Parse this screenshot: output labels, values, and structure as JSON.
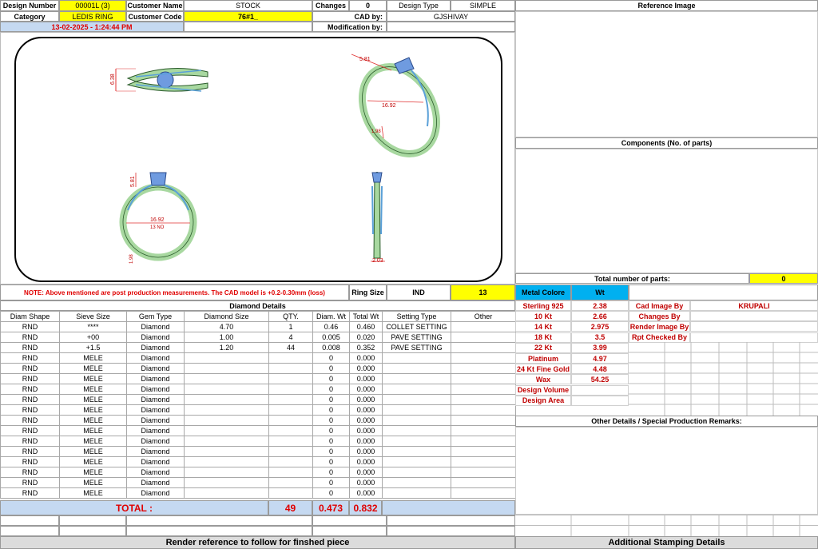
{
  "header": {
    "design_number_label": "Design Number",
    "design_number": "00001L (3)",
    "customer_name_label": "Customer Name",
    "customer_name": "STOCK",
    "changes_label": "Changes",
    "changes": "0",
    "design_type_label": "Design Type",
    "design_type": "SIMPLE",
    "category_label": "Category",
    "category": "LEDIS RING",
    "customer_code_label": "Customer Code",
    "customer_code": "76#1_",
    "cad_by_label": "CAD by:",
    "cad_by": "GJSHIVAY",
    "date": "13-02-2025 - 1:24:44 PM",
    "modification_label": "Modification by:"
  },
  "right_panel": {
    "reference_image": "Reference Image",
    "components": "Components (No. of parts)",
    "total_parts_label": "Total number of parts:",
    "total_parts": "0",
    "other_details": "Other Details / Special Production Remarks:",
    "stamping": "Additional Stamping Details"
  },
  "drawing": {
    "dim_top_height": "6.38",
    "dim_side_height": "5.81",
    "dim_side_width": "16.92",
    "dim_side_shank": "1.98",
    "dim_front_height": "5.81",
    "dim_front_width": "16.92",
    "dim_front_size": "13 NO",
    "dim_front_shank": "1.98",
    "dim_profile": "2.03"
  },
  "note": {
    "text": "NOTE: Above mentioned are post production measurements. The CAD model is +0.2-0.30mm (loss)",
    "ring_size_label": "Ring Size",
    "ring_size_system": "IND",
    "ring_size": "13",
    "metal_colore_label": "Metal Colore",
    "wt_label": "Wt"
  },
  "diamond": {
    "title": "Diamond Details",
    "headers": [
      "Diam Shape",
      "Sieve Size",
      "Gem Type",
      "Diamond Size",
      "QTY.",
      "Diam. Wt",
      "Total Wt",
      "Setting Type",
      "Other"
    ],
    "rows": [
      [
        "RND",
        "****",
        "Diamond",
        "4.70",
        "1",
        "0.46",
        "0.460",
        "COLLET SETTING",
        ""
      ],
      [
        "RND",
        "+00",
        "Diamond",
        "1.00",
        "4",
        "0.005",
        "0.020",
        "PAVE SETTING",
        ""
      ],
      [
        "RND",
        "+1.5",
        "Diamond",
        "1.20",
        "44",
        "0.008",
        "0.352",
        "PAVE SETTING",
        ""
      ],
      [
        "RND",
        "MELE",
        "Diamond",
        "",
        "",
        "0",
        "0.000",
        "",
        ""
      ],
      [
        "RND",
        "MELE",
        "Diamond",
        "",
        "",
        "0",
        "0.000",
        "",
        ""
      ],
      [
        "RND",
        "MELE",
        "Diamond",
        "",
        "",
        "0",
        "0.000",
        "",
        ""
      ],
      [
        "RND",
        "MELE",
        "Diamond",
        "",
        "",
        "0",
        "0.000",
        "",
        ""
      ],
      [
        "RND",
        "MELE",
        "Diamond",
        "",
        "",
        "0",
        "0.000",
        "",
        ""
      ],
      [
        "RND",
        "MELE",
        "Diamond",
        "",
        "",
        "0",
        "0.000",
        "",
        ""
      ],
      [
        "RND",
        "MELE",
        "Diamond",
        "",
        "",
        "0",
        "0.000",
        "",
        ""
      ],
      [
        "RND",
        "MELE",
        "Diamond",
        "",
        "",
        "0",
        "0.000",
        "",
        ""
      ],
      [
        "RND",
        "MELE",
        "Diamond",
        "",
        "",
        "0",
        "0.000",
        "",
        ""
      ],
      [
        "RND",
        "MELE",
        "Diamond",
        "",
        "",
        "0",
        "0.000",
        "",
        ""
      ],
      [
        "RND",
        "MELE",
        "Diamond",
        "",
        "",
        "0",
        "0.000",
        "",
        ""
      ],
      [
        "RND",
        "MELE",
        "Diamond",
        "",
        "",
        "0",
        "0.000",
        "",
        ""
      ],
      [
        "RND",
        "MELE",
        "Diamond",
        "",
        "",
        "0",
        "0.000",
        "",
        ""
      ],
      [
        "RND",
        "MELE",
        "Diamond",
        "",
        "",
        "0",
        "0.000",
        "",
        ""
      ]
    ],
    "total_label": "TOTAL :",
    "total_qty": "49",
    "total_diam_wt": "0.473",
    "total_wt": "0.832"
  },
  "metals": [
    {
      "name": "Sterling 925",
      "wt": "2.38"
    },
    {
      "name": "10 Kt",
      "wt": "2.66"
    },
    {
      "name": "14 Kt",
      "wt": "2.975"
    },
    {
      "name": "18 Kt",
      "wt": "3.5"
    },
    {
      "name": "22 Kt",
      "wt": "3.99"
    },
    {
      "name": "Platinum",
      "wt": "4.97"
    },
    {
      "name": "24 Kt Fine Gold",
      "wt": "4.48"
    },
    {
      "name": "Wax",
      "wt": "54.25"
    },
    {
      "name": "Design Volume",
      "wt": ""
    },
    {
      "name": "Design Area",
      "wt": ""
    }
  ],
  "credits": [
    {
      "label": "Cad Image By",
      "value": "KRUPALI"
    },
    {
      "label": "Changes By",
      "value": ""
    },
    {
      "label": "Render Image By",
      "value": ""
    },
    {
      "label": "Rpt Checked By",
      "value": ""
    }
  ],
  "footer": {
    "render_reference": "Render reference to follow for finshed piece"
  }
}
